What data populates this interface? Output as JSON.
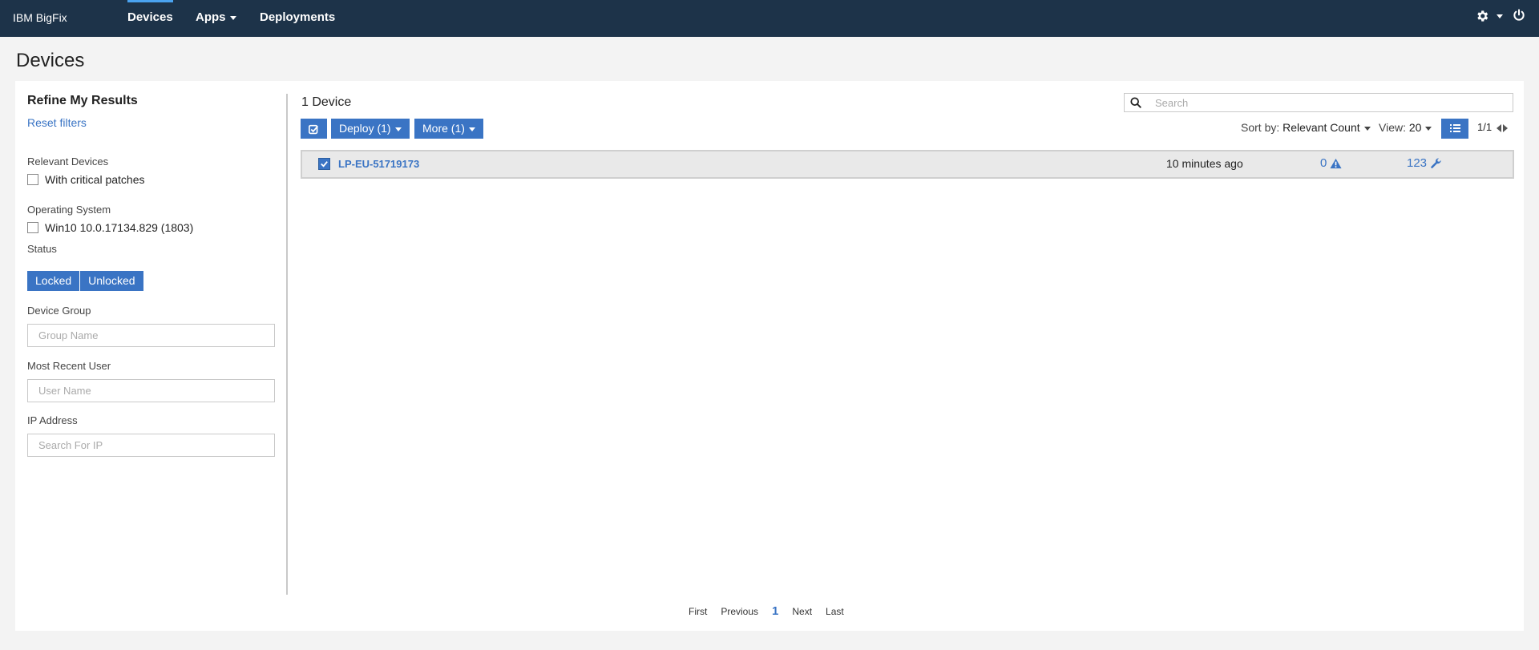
{
  "header": {
    "brand": "IBM BigFix",
    "nav": [
      {
        "label": "Devices",
        "active": true
      },
      {
        "label": "Apps",
        "dropdown": true
      },
      {
        "label": "Deployments"
      }
    ],
    "icons": [
      "gear-icon",
      "power-icon"
    ]
  },
  "page": {
    "title": "Devices"
  },
  "sidebar": {
    "title": "Refine My Results",
    "reset": "Reset filters",
    "relevant_label": "Relevant Devices",
    "relevant_option": "With critical patches",
    "os_label": "Operating System",
    "os_option": "Win10 10.0.17134.829 (1803)",
    "status_label": "Status",
    "status_locked": "Locked",
    "status_unlocked": "Unlocked",
    "group_label": "Device Group",
    "group_placeholder": "Group Name",
    "user_label": "Most Recent User",
    "user_placeholder": "User Name",
    "ip_label": "IP Address",
    "ip_placeholder": "Search For IP"
  },
  "content": {
    "count": "1 Device",
    "search_placeholder": "Search",
    "deploy": "Deploy (1)",
    "more": "More (1)",
    "sort_label": "Sort by:",
    "sort_value": "Relevant Count",
    "view_label": "View:",
    "view_value": "20",
    "page_indicator": "1/1"
  },
  "devices": [
    {
      "name": "LP-EU-51719173",
      "last_seen": "10 minutes ago",
      "critical": "0",
      "patches": "123",
      "selected": true
    }
  ],
  "pagination": {
    "first": "First",
    "previous": "Previous",
    "current": "1",
    "next": "Next",
    "last": "Last"
  },
  "colors": {
    "nav_bg": "#1d3349",
    "accent": "#3a74c4"
  }
}
